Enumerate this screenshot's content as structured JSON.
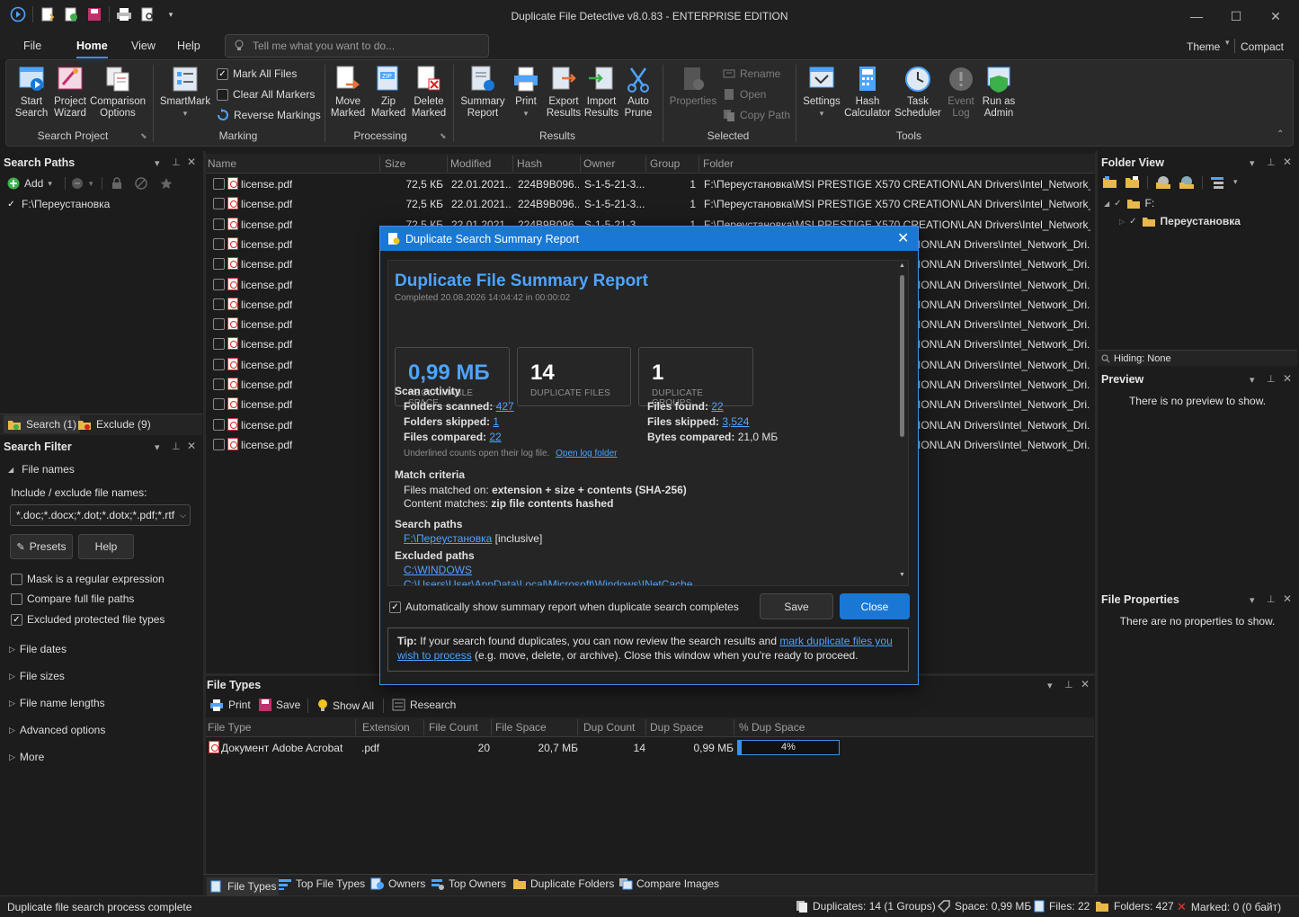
{
  "window": {
    "title": "Duplicate File Detective v8.0.83 - ENTERPRISE EDITION"
  },
  "menu": {
    "tabs": [
      "File",
      "Home",
      "View",
      "Help"
    ],
    "tell_me_placeholder": "Tell me what you want to do...",
    "theme": "Theme",
    "compact": "Compact"
  },
  "ribbon": {
    "search_project": {
      "label": "Search Project",
      "buttons": [
        {
          "l1": "Start",
          "l2": "Search"
        },
        {
          "l1": "Project",
          "l2": "Wizard"
        },
        {
          "l1": "Comparison",
          "l2": "Options"
        }
      ]
    },
    "marking": {
      "label": "Marking",
      "smartmark": "SmartMark",
      "items": [
        "Mark All Files",
        "Clear All Markers",
        "Reverse Markings"
      ]
    },
    "processing": {
      "label": "Processing",
      "buttons": [
        {
          "l1": "Move",
          "l2": "Marked"
        },
        {
          "l1": "Zip",
          "l2": "Marked"
        },
        {
          "l1": "Delete",
          "l2": "Marked"
        }
      ]
    },
    "results": {
      "label": "Results",
      "buttons": [
        {
          "l1": "Summary",
          "l2": "Report"
        },
        {
          "l1": "Print",
          "l2": ""
        },
        {
          "l1": "Export",
          "l2": "Results"
        },
        {
          "l1": "Import",
          "l2": "Results"
        },
        {
          "l1": "Auto",
          "l2": "Prune"
        }
      ]
    },
    "selected": {
      "label": "Selected",
      "properties": "Properties",
      "items": [
        "Rename",
        "Open",
        "Copy Path"
      ]
    },
    "tools": {
      "label": "Tools",
      "buttons": [
        {
          "l1": "Settings",
          "l2": ""
        },
        {
          "l1": "Hash",
          "l2": "Calculator"
        },
        {
          "l1": "Task",
          "l2": "Scheduler"
        },
        {
          "l1": "Event",
          "l2": "Log"
        },
        {
          "l1": "Run as",
          "l2": "Admin"
        }
      ]
    }
  },
  "search_paths": {
    "title": "Search Paths",
    "add": "Add",
    "path": "F:\\Переустановка",
    "tab_search": "Search (1)",
    "tab_exclude": "Exclude (9)"
  },
  "search_filter": {
    "title": "Search Filter",
    "file_names": "File names",
    "include_label": "Include / exclude file names:",
    "include_value": "*.doc;*.docx;*.dot;*.dotx;*.pdf;*.rtf",
    "presets": "Presets",
    "help": "Help",
    "options": [
      {
        "label": "Mask is a regular expression",
        "checked": false
      },
      {
        "label": "Compare full file paths",
        "checked": false
      },
      {
        "label": "Excluded protected file types",
        "checked": true
      }
    ],
    "sections": [
      "File dates",
      "File sizes",
      "File name lengths",
      "Advanced options",
      "More"
    ]
  },
  "grid": {
    "columns": [
      "Name",
      "Size",
      "Modified",
      "Hash",
      "Owner",
      "Group",
      "Folder"
    ],
    "rows": [
      {
        "name": "license.pdf",
        "size": "72,5 КБ",
        "modified": "22.01.2021...",
        "hash": "224B9B096...",
        "owner": "S-1-5-21-3...",
        "group": "1",
        "folder": "F:\\Переустановка\\MSI PRESTIGE X570 CREATION\\LAN Drivers\\Intel_Network_Dri..."
      },
      {
        "name": "license.pdf",
        "size": "72,5 КБ",
        "modified": "22.01.2021...",
        "hash": "224B9B096...",
        "owner": "S-1-5-21-3...",
        "group": "1",
        "folder": "F:\\Переустановка\\MSI PRESTIGE X570 CREATION\\LAN Drivers\\Intel_Network_Dri..."
      },
      {
        "name": "license.pdf",
        "size": "72,5 КБ",
        "modified": "22.01.2021...",
        "hash": "224B9B096...",
        "owner": "S-1-5-21-3...",
        "group": "1",
        "folder": "F:\\Переустановка\\MSI PRESTIGE X570 CREATION\\LAN Drivers\\Intel_Network_Dri..."
      },
      {
        "name": "license.pdf",
        "folder": "ION\\LAN Drivers\\Intel_Network_Dri..."
      },
      {
        "name": "license.pdf",
        "folder": "ION\\LAN Drivers\\Intel_Network_Dri..."
      },
      {
        "name": "license.pdf",
        "folder": "ION\\LAN Drivers\\Intel_Network_Dri..."
      },
      {
        "name": "license.pdf",
        "folder": "ION\\LAN Drivers\\Intel_Network_Dri..."
      },
      {
        "name": "license.pdf",
        "folder": "ION\\LAN Drivers\\Intel_Network_Dri..."
      },
      {
        "name": "license.pdf",
        "folder": "ION\\LAN Drivers\\Intel_Network_Dri..."
      },
      {
        "name": "license.pdf",
        "folder": "ION\\LAN Drivers\\Intel_Network_Dri..."
      },
      {
        "name": "license.pdf",
        "folder": "ION\\LAN Drivers\\Intel_Network_Dri..."
      },
      {
        "name": "license.pdf",
        "folder": "ION\\LAN Drivers\\Intel_Network_Dri..."
      },
      {
        "name": "license.pdf",
        "folder": "ION\\LAN Drivers\\Intel_Network_Dri..."
      },
      {
        "name": "license.pdf",
        "folder": "ION\\LAN Drivers\\Intel_Network_Dri..."
      }
    ]
  },
  "folder_view": {
    "title": "Folder View",
    "root": "F:",
    "child": "Переустановка",
    "hiding": "Hiding: None"
  },
  "preview": {
    "title": "Preview",
    "empty": "There is no preview to show."
  },
  "file_properties": {
    "title": "File Properties",
    "empty": "There are no properties to show."
  },
  "file_types": {
    "title": "File Types",
    "toolbar": [
      "Print",
      "Save",
      "Show All",
      "Research"
    ],
    "columns": [
      "File Type",
      "Extension",
      "File Count",
      "File Space",
      "Dup Count",
      "Dup Space",
      "% Dup Space"
    ],
    "rows": [
      {
        "type": "Документ Adobe Acrobat",
        "ext": ".pdf",
        "count": "20",
        "space": "20,7 МБ",
        "dup_count": "14",
        "dup_space": "0,99 МБ",
        "pct": "4%",
        "pct_value": 4
      }
    ]
  },
  "bottom_tabs": [
    "File Types",
    "Top File Types",
    "Owners",
    "Top Owners",
    "Duplicate Folders",
    "Compare Images"
  ],
  "status": {
    "message": "Duplicate file search process complete",
    "duplicates": "Duplicates: 14 (1 Groups)",
    "space": "Space: 0,99 МБ",
    "files": "Files: 22",
    "folders": "Folders: 427",
    "marked": "Marked: 0 (0 байт)"
  },
  "dialog": {
    "title": "Duplicate Search Summary Report",
    "heading": "Duplicate File Summary Report",
    "completed": "Completed 20.08.2026 14:04:42 in 00:00:02",
    "cards": [
      {
        "value": "0,99 МБ",
        "label": "RECLAIMABLE SPACE"
      },
      {
        "value": "14",
        "label": "DUPLICATE FILES"
      },
      {
        "value": "1",
        "label": "DUPLICATE GROUPS"
      }
    ],
    "scan_activity": "Scan activity",
    "stats_left": [
      {
        "k": "Folders scanned:",
        "v": "427"
      },
      {
        "k": "Folders skipped:",
        "v": "1"
      },
      {
        "k": "Files compared:",
        "v": "22"
      }
    ],
    "stats_right": [
      {
        "k": "Files found:",
        "v": "22",
        "link": true
      },
      {
        "k": "Files skipped:",
        "v": "3,524",
        "link": true
      },
      {
        "k": "Bytes compared:",
        "v": "21,0 МБ",
        "link": false
      }
    ],
    "underline_note": "Underlined counts open their log file.",
    "open_log": "Open log folder",
    "match_criteria": "Match criteria",
    "matched_on_label": "Files matched on:",
    "matched_on_value": "extension + size + contents (SHA-256)",
    "content_label": "Content matches:",
    "content_value": "zip file contents hashed",
    "search_paths_title": "Search paths",
    "search_path": "F:\\Переустановка",
    "search_path_note": "[inclusive]",
    "excluded_title": "Excluded paths",
    "excluded": [
      "C:\\WINDOWS",
      "C:\\Users\\User\\AppData\\Local\\Microsoft\\Windows\\INetCache"
    ],
    "auto_show": "Automatically show summary report when duplicate search completes",
    "save": "Save",
    "close": "Close",
    "tip_label": "Tip:",
    "tip_text1": "If your search found duplicates, you can now review the search results and",
    "tip_link": "mark duplicate files you wish to process",
    "tip_text2": "(e.g. move, delete, or archive). Close this window when you're ready to proceed."
  }
}
